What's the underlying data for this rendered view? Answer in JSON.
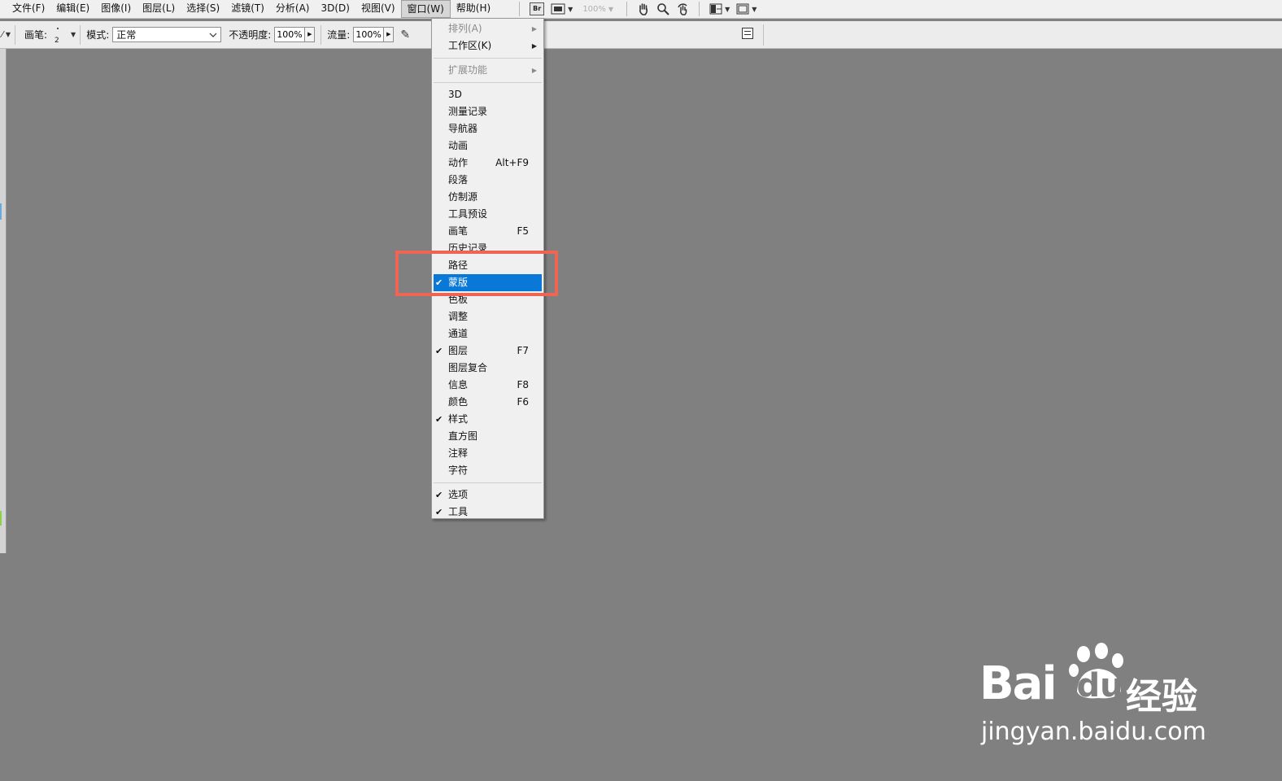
{
  "menubar": {
    "items": [
      "文件(F)",
      "编辑(E)",
      "图像(I)",
      "图层(L)",
      "选择(S)",
      "滤镜(T)",
      "分析(A)",
      "3D(D)",
      "视图(V)",
      "窗口(W)",
      "帮助(H)"
    ],
    "open_index": 9,
    "zoom": "100%",
    "bridge_label": "Br"
  },
  "options": {
    "brush_label": "画笔:",
    "brush_size": "2",
    "mode_label": "模式:",
    "mode_value": "正常",
    "opacity_label": "不透明度:",
    "opacity_value": "100%",
    "flow_label": "流量:",
    "flow_value": "100%"
  },
  "window_menu": {
    "items": [
      {
        "label": "排列(A)",
        "disabled": true,
        "submenu": true
      },
      {
        "label": "工作区(K)",
        "submenu": true
      },
      {
        "separator": true
      },
      {
        "label": "扩展功能",
        "disabled": true,
        "submenu": true
      },
      {
        "separator": true
      },
      {
        "label": "3D"
      },
      {
        "label": "测量记录"
      },
      {
        "label": "导航器"
      },
      {
        "label": "动画"
      },
      {
        "label": "动作",
        "shortcut": "Alt+F9"
      },
      {
        "label": "段落"
      },
      {
        "label": "仿制源"
      },
      {
        "label": "工具预设"
      },
      {
        "label": "画笔",
        "shortcut": "F5"
      },
      {
        "label": "历史记录"
      },
      {
        "label": "路径"
      },
      {
        "label": "蒙版",
        "checked": true,
        "selected": true
      },
      {
        "label": "色板"
      },
      {
        "label": "调整"
      },
      {
        "label": "通道"
      },
      {
        "label": "图层",
        "checked": true,
        "shortcut": "F7"
      },
      {
        "label": "图层复合"
      },
      {
        "label": "信息",
        "shortcut": "F8"
      },
      {
        "label": "颜色",
        "shortcut": "F6"
      },
      {
        "label": "样式",
        "checked": true
      },
      {
        "label": "直方图"
      },
      {
        "label": "注释"
      },
      {
        "label": "字符"
      },
      {
        "separator": true
      },
      {
        "label": "选项",
        "checked": true
      },
      {
        "label": "工具",
        "checked": true
      }
    ]
  },
  "watermark": {
    "brand_latin": "Bai",
    "brand_du": "du",
    "brand_cn": "经验",
    "url": "jingyan.baidu.com"
  },
  "colors": {
    "canvas": "#808080",
    "highlight": "#0a78d7",
    "annotation": "#f06454"
  }
}
